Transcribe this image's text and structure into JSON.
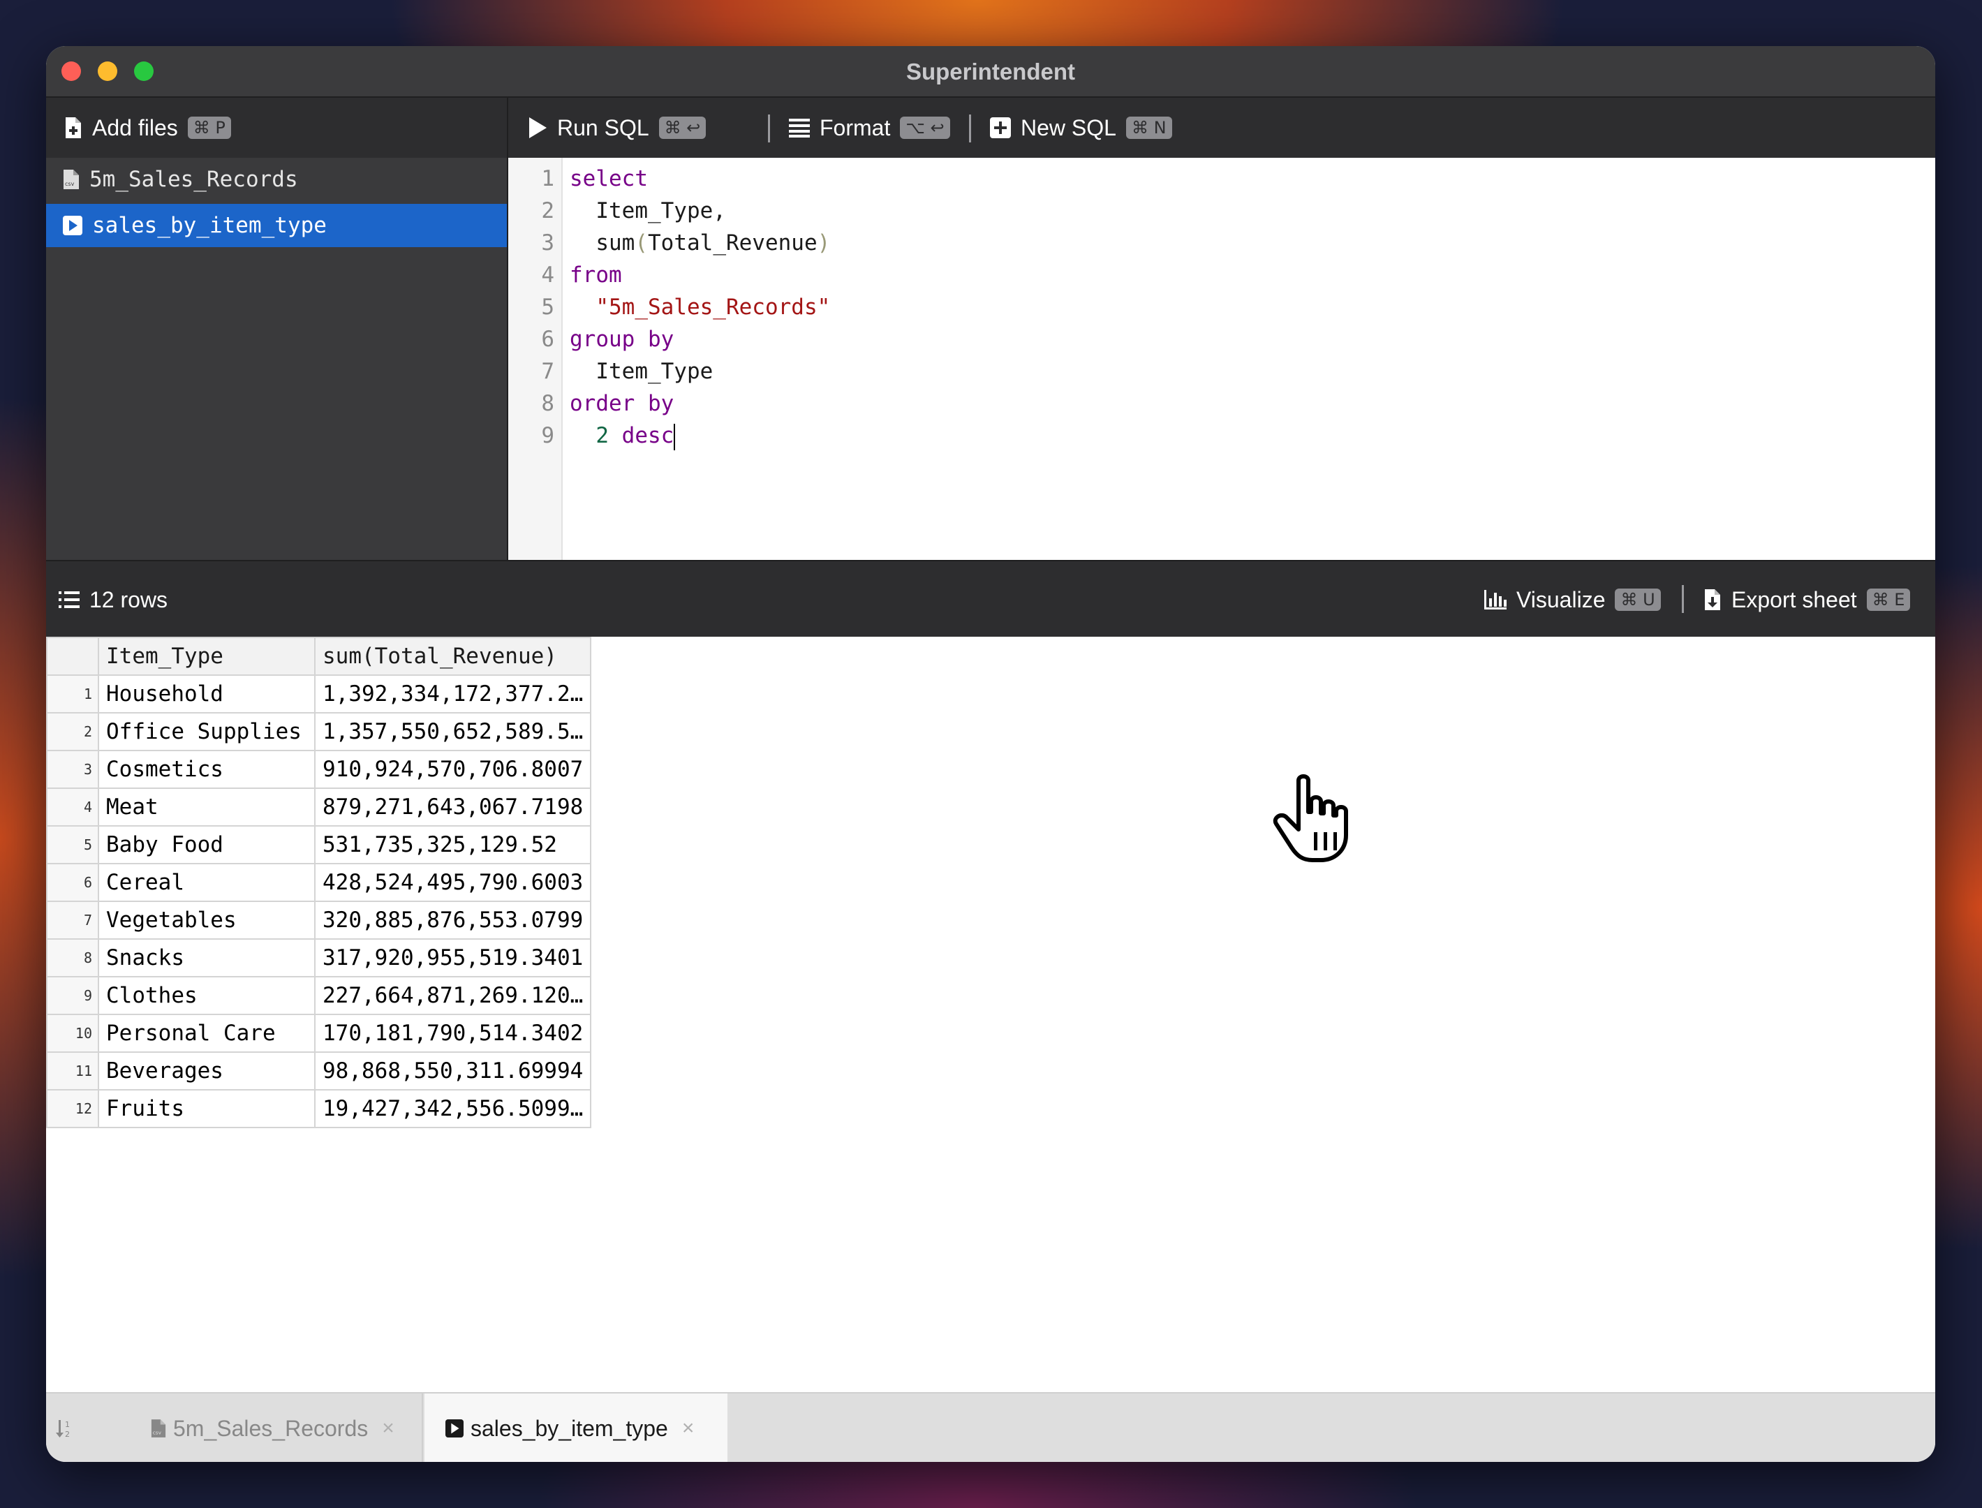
{
  "window": {
    "title": "Superintendent"
  },
  "sidebar_toolbar": {
    "add_files_label": "Add files",
    "add_files_shortcut": "⌘ P"
  },
  "editor_toolbar": {
    "run_sql_label": "Run SQL",
    "run_sql_shortcut": "⌘ ↩",
    "format_label": "Format",
    "format_shortcut": "⌥ ↩",
    "new_sql_label": "New SQL",
    "new_sql_shortcut": "⌘ N"
  },
  "sidebar": {
    "items": [
      {
        "label": "5m_Sales_Records",
        "icon": "csv-file-icon",
        "active": false
      },
      {
        "label": "sales_by_item_type",
        "icon": "sql-query-icon",
        "active": true
      }
    ]
  },
  "editor": {
    "line_numbers": [
      "1",
      "2",
      "3",
      "4",
      "5",
      "6",
      "7",
      "8",
      "9"
    ],
    "lines": {
      "l1_kw": "select",
      "l2": "  Item_Type,",
      "l3_fn": "  sum",
      "l3_open": "(",
      "l3_arg": "Total_Revenue",
      "l3_close": ")",
      "l4_kw": "from",
      "l5_str": "\"5m_Sales_Records\"",
      "l6_kw": "group by",
      "l7": "  Item_Type",
      "l8_kw": "order by",
      "l9_num": "2",
      "l9_kw": "desc"
    }
  },
  "results_bar": {
    "row_count": "12 rows",
    "visualize_label": "Visualize",
    "visualize_shortcut": "⌘ U",
    "export_label": "Export sheet",
    "export_shortcut": "⌘ E"
  },
  "grid": {
    "columns": [
      "Item_Type",
      "sum(Total_Revenue)"
    ],
    "rows": [
      {
        "n": "1",
        "item": "Household",
        "revenue": "1,392,334,172,377.2…"
      },
      {
        "n": "2",
        "item": "Office Supplies",
        "revenue": "1,357,550,652,589.5…"
      },
      {
        "n": "3",
        "item": "Cosmetics",
        "revenue": "910,924,570,706.8007"
      },
      {
        "n": "4",
        "item": "Meat",
        "revenue": "879,271,643,067.7198"
      },
      {
        "n": "5",
        "item": "Baby Food",
        "revenue": "531,735,325,129.52"
      },
      {
        "n": "6",
        "item": "Cereal",
        "revenue": "428,524,495,790.6003"
      },
      {
        "n": "7",
        "item": "Vegetables",
        "revenue": "320,885,876,553.0799"
      },
      {
        "n": "8",
        "item": "Snacks",
        "revenue": "317,920,955,519.3401"
      },
      {
        "n": "9",
        "item": "Clothes",
        "revenue": "227,664,871,269.120…"
      },
      {
        "n": "10",
        "item": "Personal Care",
        "revenue": "170,181,790,514.3402"
      },
      {
        "n": "11",
        "item": "Beverages",
        "revenue": "98,868,550,311.69994"
      },
      {
        "n": "12",
        "item": "Fruits",
        "revenue": "19,427,342,556.5099…"
      }
    ]
  },
  "bottom_tabs": {
    "tabs": [
      {
        "label": "5m_Sales_Records",
        "active": false
      },
      {
        "label": "sales_by_item_type",
        "active": true
      }
    ],
    "close_glyph": "×"
  },
  "colors": {
    "accent": "#1c65c9",
    "toolbar_bg": "#2d2d2f",
    "sidebar_bg": "#3a3a3c"
  }
}
